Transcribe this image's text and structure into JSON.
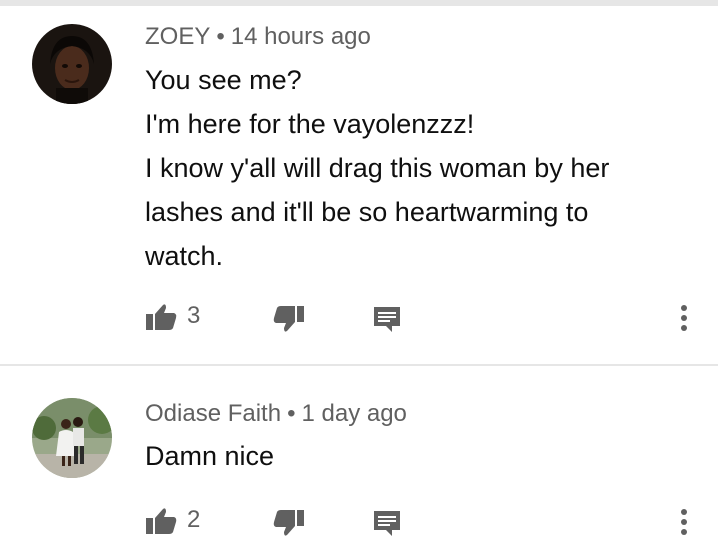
{
  "comments": [
    {
      "author": "ZOEY",
      "separator": "•",
      "time": "14 hours ago",
      "lines": [
        "You see me?",
        "I'm here for the vayolenzzz!",
        "I know y'all will drag this woman by her",
        "lashes and it'll be so heartwarming to",
        "watch."
      ],
      "likes": "3"
    },
    {
      "author": "Odiase Faith",
      "separator": "•",
      "time": "1 day ago",
      "lines": [
        "Damn nice"
      ],
      "likes": "2"
    }
  ],
  "icons": {
    "like": "thumbs-up-icon",
    "dislike": "thumbs-down-icon",
    "reply": "reply-comment-icon",
    "more": "more-vertical-icon"
  },
  "colors": {
    "text": "#0f0f0f",
    "secondary": "#606060",
    "divider": "#e6e6e6"
  }
}
